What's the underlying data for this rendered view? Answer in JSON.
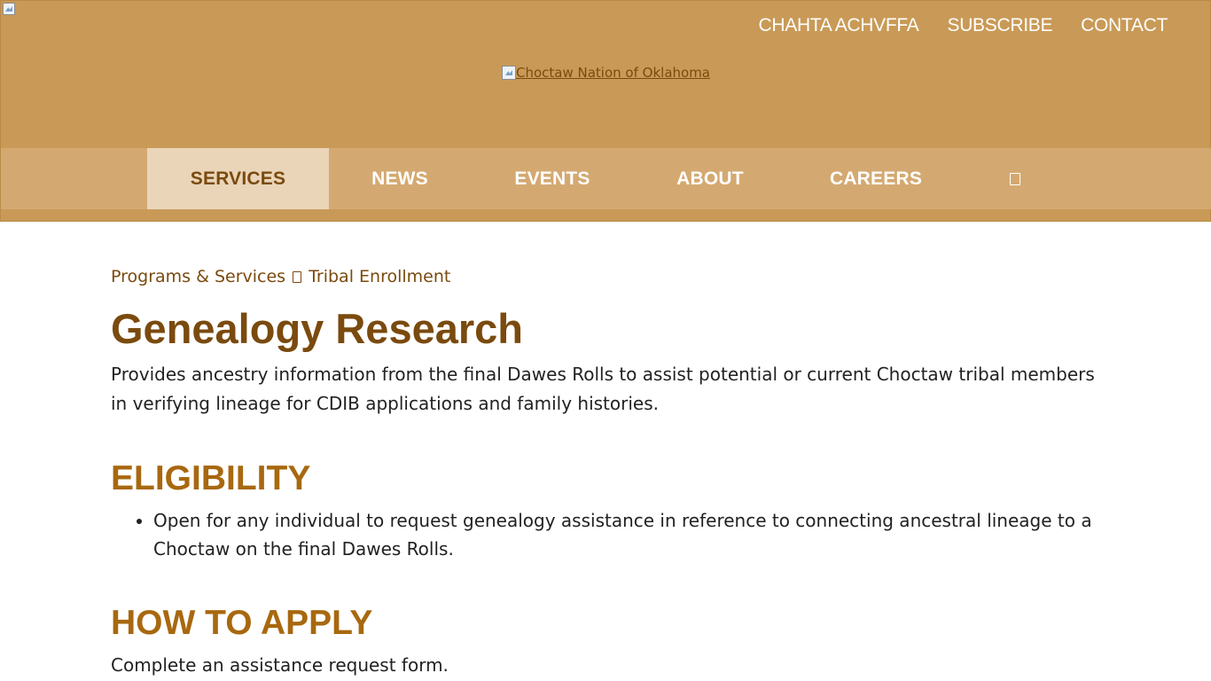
{
  "header": {
    "utility_nav": [
      "CHAHTA ACHVFFA",
      "SUBSCRIBE",
      "CONTACT"
    ],
    "logo_alt": "Choctaw Nation of Oklahoma"
  },
  "main_nav": {
    "items": [
      {
        "label": "SERVICES",
        "active": true
      },
      {
        "label": "NEWS",
        "active": false
      },
      {
        "label": "EVENTS",
        "active": false
      },
      {
        "label": "ABOUT",
        "active": false
      },
      {
        "label": "CAREERS",
        "active": false
      }
    ],
    "search_icon": "search-icon"
  },
  "breadcrumb": {
    "parent": "Programs & Services",
    "current": "Tribal Enrollment",
    "separator_icon": "chevron-right-icon"
  },
  "page": {
    "title": "Genealogy Research",
    "intro": "Provides ancestry information from the final Dawes Rolls to assist potential or current Choctaw tribal members in verifying lineage for CDIB applications and family histories.",
    "sections": [
      {
        "heading": "ELIGIBILITY",
        "bullets": [
          "Open for any individual to request genealogy assistance in reference to connecting ancestral lineage to a Choctaw on the final Dawes Rolls."
        ]
      },
      {
        "heading": "HOW TO APPLY",
        "text": "Complete an assistance request form."
      }
    ]
  },
  "colors": {
    "header_bg": "#c99a57",
    "nav_bg": "#d4a971",
    "nav_active_bg": "#ead5b9",
    "title_brown": "#7a4a0e",
    "heading_gold": "#a8680f",
    "body_text": "#222222"
  }
}
